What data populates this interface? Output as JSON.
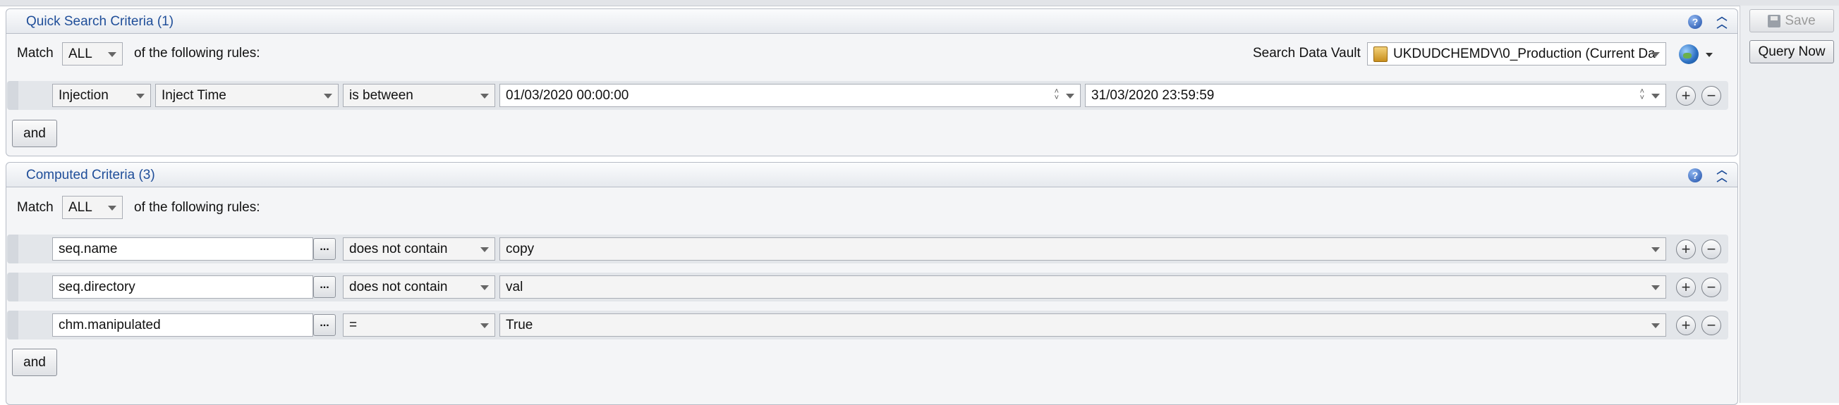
{
  "side": {
    "save_label": "Save",
    "query_now_label": "Query Now"
  },
  "quick": {
    "title": "Quick Search Criteria (1)",
    "match_label": "Match",
    "match_value": "ALL",
    "following_label": "of the following rules:",
    "vault_label": "Search Data Vault",
    "vault_value": "UKDUDCHEMDV\\0_Production (Current Da",
    "rule": {
      "category": "Injection",
      "field": "Inject Time",
      "operator": "is between",
      "from": "01/03/2020 00:00:00",
      "to": "31/03/2020 23:59:59"
    },
    "and_label": "and"
  },
  "computed": {
    "title": "Computed Criteria (3)",
    "match_label": "Match",
    "match_value": "ALL",
    "following_label": "of the following rules:",
    "rules": [
      {
        "field": "seq.name",
        "operator": "does not contain",
        "value": "copy"
      },
      {
        "field": "seq.directory",
        "operator": "does not contain",
        "value": "val"
      },
      {
        "field": "chm.manipulated",
        "operator": "=",
        "value": "True"
      }
    ],
    "and_label": "and"
  },
  "icons": {
    "help": "help-icon",
    "collapse": "collapse-up-icon",
    "add": "add-rule-icon",
    "remove": "remove-rule-icon",
    "globe": "globe-icon",
    "vault": "data-vault-icon"
  }
}
